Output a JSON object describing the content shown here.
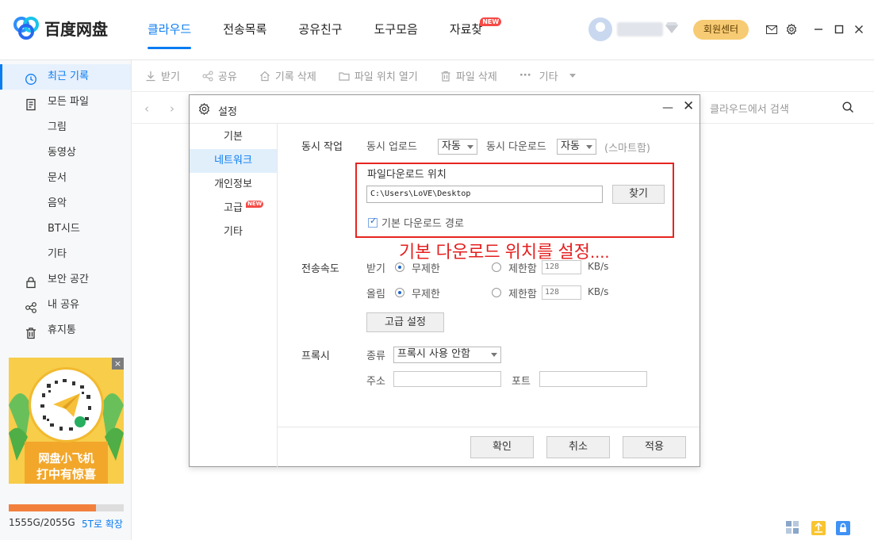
{
  "app": {
    "logo_text": "百度网盘",
    "nav": [
      {
        "label": "클라우드",
        "active": true
      },
      {
        "label": "전송목록"
      },
      {
        "label": "공유친구"
      },
      {
        "label": "도구모음"
      },
      {
        "label": "자료찾",
        "badge": "NEW"
      }
    ],
    "member_button": "회원센터",
    "accent": "#0a7cf2"
  },
  "sidebar": {
    "items": [
      {
        "label": "최근 기록",
        "icon": "clock-icon",
        "active": true
      },
      {
        "label": "모든 파일",
        "icon": "document-icon"
      },
      {
        "label": "그림"
      },
      {
        "label": "동영상"
      },
      {
        "label": "문서"
      },
      {
        "label": "음악"
      },
      {
        "label": "BT시드"
      },
      {
        "label": "기타"
      },
      {
        "label": "보안 공간",
        "icon": "lock-icon"
      },
      {
        "label": "내 공유",
        "icon": "share-icon"
      },
      {
        "label": "휴지통",
        "icon": "trash-icon"
      }
    ],
    "ad": {
      "line1": "网盘小飞机",
      "line2": "打中有惊喜",
      "close": "×"
    },
    "storage": {
      "text": "1555G/2055G",
      "used_fraction": 0.757,
      "expand": "5T로 확장"
    }
  },
  "toolbar": {
    "items": [
      "받기",
      "공유",
      "기록 삭제",
      "파일 위치 열기",
      "파일 삭제",
      "기타"
    ],
    "more_dots": "···"
  },
  "pathbar": {
    "back": "‹",
    "forward": "›",
    "search_placeholder": "클라우드에서 검색"
  },
  "dialog": {
    "title": "설정",
    "minimize": "—",
    "close": "✕",
    "nav": [
      {
        "label": "기본"
      },
      {
        "label": "네트워크",
        "active": true
      },
      {
        "label": "개인정보"
      },
      {
        "label": "고급",
        "badge": "NEW"
      },
      {
        "label": "기타"
      }
    ],
    "concurrent": {
      "section": "동시 작업",
      "upload_label": "동시 업로드",
      "upload_value": "자동",
      "download_label": "동시 다운로드",
      "download_value": "자동",
      "smart": "(스마트함)"
    },
    "download_location": {
      "title": "파일다운로드 위치",
      "path": "C:\\Users\\LoVE\\Desktop",
      "find_button": "찾기",
      "default_checkbox": "기본 다운로드 경로",
      "default_checked": true
    },
    "annotation": "기본 다운로드 위치를 설정....",
    "speed": {
      "section": "전송속도",
      "download_label": "받기",
      "upload_label": "올림",
      "unlimited": "무제한",
      "limited": "제한함",
      "download_limit": "128",
      "upload_limit": "128",
      "unit": "KB/s",
      "advanced_button": "고급 설정"
    },
    "proxy": {
      "section": "프록시",
      "type_label": "종류",
      "type_value": "프록시 사용 안함",
      "address_label": "주소",
      "port_label": "포트"
    },
    "buttons": {
      "ok": "확인",
      "cancel": "취소",
      "apply": "적용"
    }
  }
}
